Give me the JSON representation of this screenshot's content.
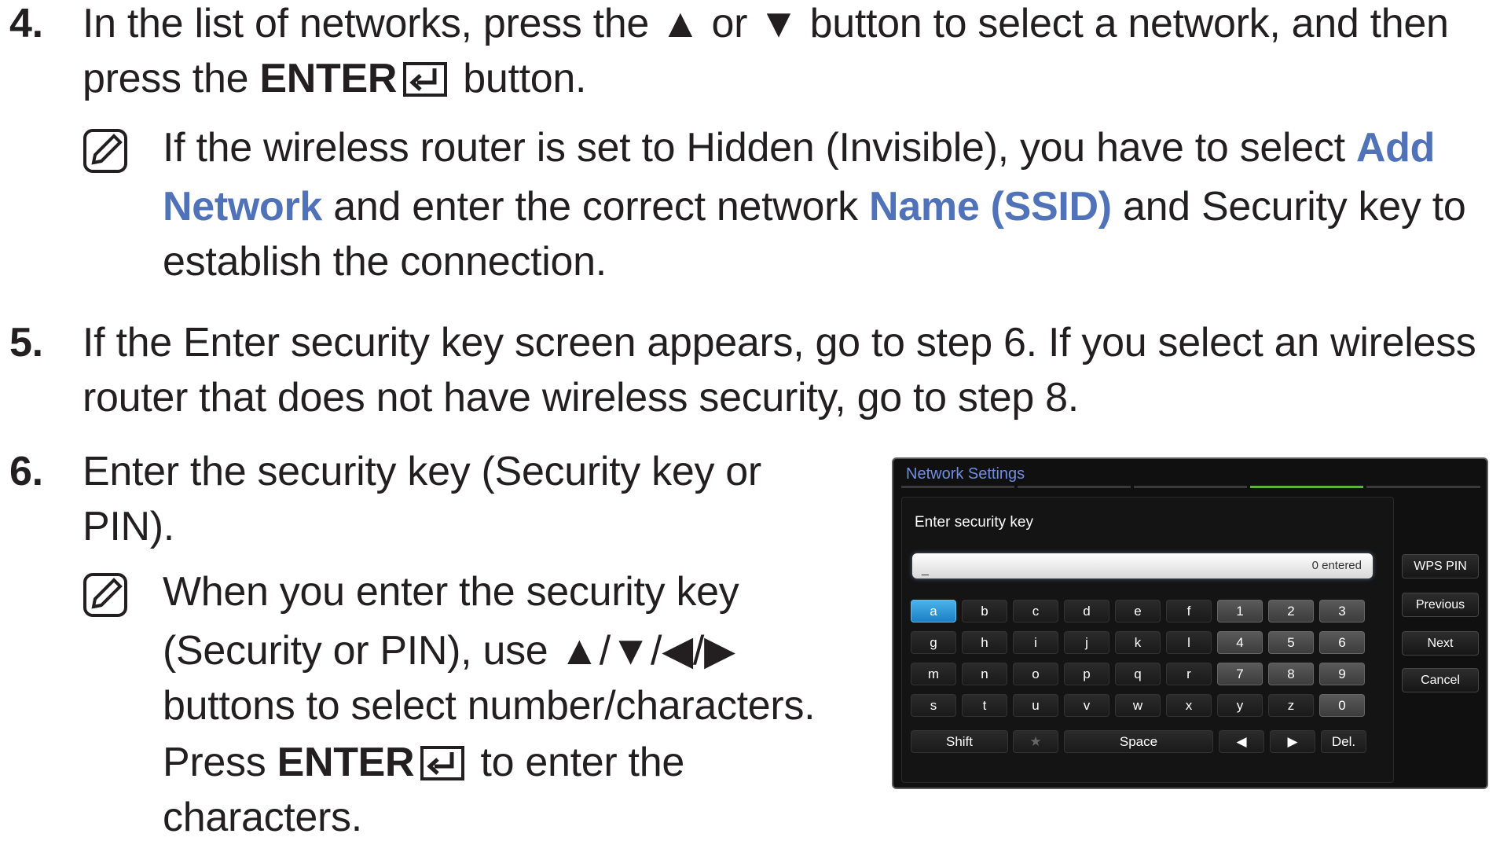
{
  "step4": {
    "number": "4.",
    "line1": "In the list of networks, press the ▲ or ▼ button to select a network, and then",
    "line2_pre": "press the ",
    "line2_bold": "ENTER",
    "line2_post": " button.",
    "note": {
      "line1_pre": "If the wireless router is set to Hidden (Invisible), you have to select ",
      "line1_hl": "Add",
      "line2_hl1": "Network",
      "line2_mid": " and enter the correct network ",
      "line2_hl2": "Name (SSID)",
      "line2_post": " and Security key to",
      "line3": "establish the connection."
    }
  },
  "step5": {
    "number": "5.",
    "line1": "If the Enter security key screen appears, go to step 6. If you select an wireless",
    "line2": "router that does not have wireless security, go to step 8."
  },
  "step6": {
    "number": "6.",
    "line1": "Enter the security key (Security key or",
    "line2": "PIN).",
    "note": {
      "line1": "When you enter the security key",
      "line2": "(Security or PIN), use ▲/▼/◀/▶",
      "line3": "buttons to select number/characters.",
      "line4_pre": "Press ",
      "line4_bold": "ENTER",
      "line4_post": " to enter the",
      "line5": "characters."
    }
  },
  "tv": {
    "title": "Network Settings",
    "label": "Enter security key",
    "input_value": "_",
    "entered": "0 entered",
    "rows": [
      [
        "a",
        "b",
        "c",
        "d",
        "e",
        "f",
        "1",
        "2",
        "3"
      ],
      [
        "g",
        "h",
        "i",
        "j",
        "k",
        "l",
        "4",
        "5",
        "6"
      ],
      [
        "m",
        "n",
        "o",
        "p",
        "q",
        "r",
        "7",
        "8",
        "9"
      ],
      [
        "s",
        "t",
        "u",
        "v",
        "w",
        "x",
        "y",
        "z",
        "0"
      ]
    ],
    "bottom": {
      "shift": "Shift",
      "star": "★",
      "space": "Space",
      "left": "◀",
      "right": "▶",
      "del": "Del."
    },
    "side_buttons": [
      "WPS PIN",
      "Previous",
      "Next",
      "Cancel"
    ],
    "selected_key": "a",
    "accent_active": "#58b43d"
  }
}
